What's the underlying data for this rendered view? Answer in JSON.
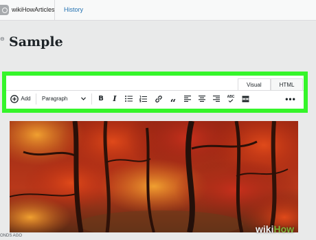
{
  "topbar": {
    "site_name": "wikiHowArticles",
    "history_label": "History"
  },
  "editor": {
    "post_title": "Sample",
    "mode_tabs": [
      {
        "label": "Visual",
        "active": true
      },
      {
        "label": "HTML",
        "active": false
      }
    ],
    "toolbar": {
      "add_label": "Add",
      "format_value": "Paragraph",
      "buttons": [
        "bold-icon",
        "italic-icon",
        "bulleted-list-icon",
        "numbered-list-icon",
        "link-icon",
        "blockquote-icon",
        "align-left-icon",
        "align-center-icon",
        "align-right-icon",
        "spellcheck-icon",
        "read-more-icon",
        "more-options-icon"
      ],
      "spellcheck_glyph": "ABC",
      "more_glyph": "•••"
    },
    "timestamp": "ONDS AGO"
  },
  "watermark": {
    "wiki": "wiki",
    "how": "How"
  },
  "colors": {
    "highlight": "#35f52a",
    "link": "#2271b1",
    "background": "#e9eaea"
  }
}
